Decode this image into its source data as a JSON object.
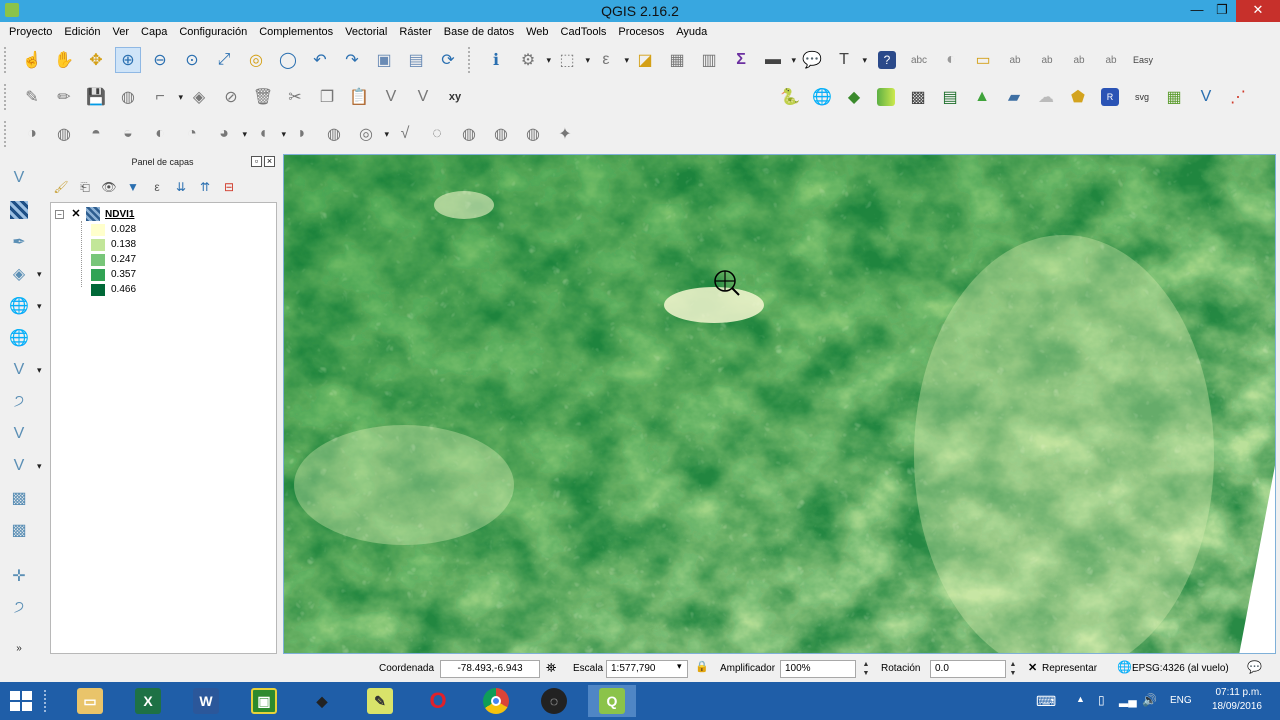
{
  "window": {
    "title": "QGIS 2.16.2",
    "minimize": "—",
    "maximize": "❐",
    "close": "✕"
  },
  "menu": [
    "Proyecto",
    "Edición",
    "Ver",
    "Capa",
    "Configuración",
    "Complementos",
    "Vectorial",
    "Ráster",
    "Base de datos",
    "Web",
    "CadTools",
    "Procesos",
    "Ayuda"
  ],
  "panel": {
    "title": "Panel de capas",
    "layer": {
      "name": "NDVI1",
      "visible_mark": "✕",
      "expander": "−",
      "legend": [
        {
          "label": "0.028",
          "color": "#ffffcc"
        },
        {
          "label": "0.138",
          "color": "#c2e699"
        },
        {
          "label": "0.247",
          "color": "#78c679"
        },
        {
          "label": "0.357",
          "color": "#31a354"
        },
        {
          "label": "0.466",
          "color": "#006837"
        }
      ]
    }
  },
  "status": {
    "coord_label": "Coordenada",
    "coord_value": "-78.493,-6.943",
    "scale_label": "Escala",
    "scale_value": "1:577,790",
    "magnifier_label": "Amplificador",
    "magnifier_value": "100%",
    "rotation_label": "Rotación",
    "rotation_value": "0.0",
    "render_label": "Representar",
    "crs_label": "EPSG:4326 (al vuelo)",
    "message_icon": "speech-bubble-icon"
  },
  "taskbar": {
    "language": "ENG",
    "time": "07:11 p.m.",
    "date": "18/09/2016"
  },
  "colors": {
    "titlebar": "#38a7e0",
    "taskbar": "#1f5ea8",
    "close": "#c7302b"
  }
}
